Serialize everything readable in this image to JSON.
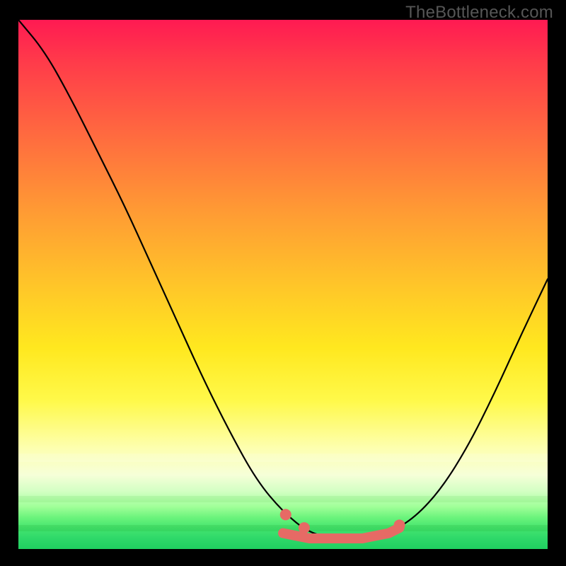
{
  "watermark": "TheBottleneck.com",
  "chart_data": {
    "type": "line",
    "title": "",
    "xlabel": "",
    "ylabel": "",
    "xlim": [
      0,
      1
    ],
    "ylim": [
      0,
      1
    ],
    "background": "vertical-gradient red→yellow→green",
    "series": [
      {
        "name": "curve",
        "color": "#000000",
        "x": [
          0.0,
          0.05,
          0.1,
          0.15,
          0.2,
          0.25,
          0.3,
          0.35,
          0.4,
          0.45,
          0.5,
          0.55,
          0.6,
          0.65,
          0.7,
          0.75,
          0.8,
          0.85,
          0.9,
          0.95,
          1.0
        ],
        "y": [
          1.0,
          0.94,
          0.85,
          0.75,
          0.65,
          0.54,
          0.43,
          0.32,
          0.22,
          0.13,
          0.07,
          0.03,
          0.02,
          0.02,
          0.03,
          0.06,
          0.115,
          0.195,
          0.295,
          0.405,
          0.51
        ]
      },
      {
        "name": "flat-highlight",
        "color": "#e66a65",
        "x": [
          0.5,
          0.55,
          0.6,
          0.65,
          0.7,
          0.72
        ],
        "y": [
          0.03,
          0.02,
          0.02,
          0.02,
          0.03,
          0.04
        ]
      }
    ],
    "annotations": [
      {
        "type": "dot",
        "x": 0.505,
        "y": 0.065,
        "color": "#e66a65"
      },
      {
        "type": "dot",
        "x": 0.54,
        "y": 0.04,
        "color": "#e66a65"
      },
      {
        "type": "dot",
        "x": 0.72,
        "y": 0.045,
        "color": "#e66a65"
      }
    ]
  }
}
